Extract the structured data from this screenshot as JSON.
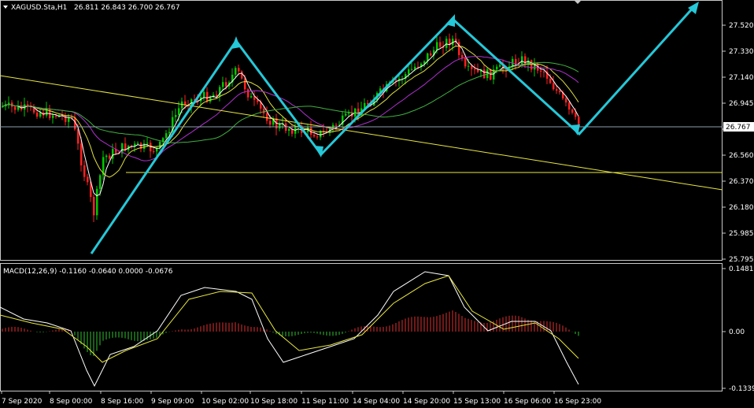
{
  "main": {
    "symbol": "XAGUSD.Sta,H1",
    "ohlc": "26.811 26.843 26.700 26.767",
    "price_ticks": [
      "27.520",
      "27.330",
      "27.140",
      "26.945",
      "26.760",
      "26.560",
      "26.370",
      "26.180",
      "25.985",
      "25.795"
    ],
    "current_price": "26.767",
    "ylim": [
      25.795,
      27.62
    ]
  },
  "macd": {
    "label": "MACD(12,26,9) -0.1160 -0.0640 0.0000 -0.0676",
    "ticks": [
      "0.1481",
      "0.00",
      "-0.1339"
    ],
    "ylim": [
      -0.1339,
      0.1481
    ]
  },
  "time_axis": {
    "labels": [
      "7 Sep 2020",
      "8 Sep 00:00",
      "8 Sep 16:00",
      "9 Sep 09:00",
      "10 Sep 02:00",
      "10 Sep 18:00",
      "11 Sep 11:00",
      "14 Sep 04:00",
      "14 Sep 20:00",
      "15 Sep 13:00",
      "16 Sep 06:00",
      "16 Sep 23:00"
    ]
  },
  "colors": {
    "bull": "#00c800",
    "bear": "#ff2020",
    "zigzag": "#25c8d8",
    "trendline": "#e8e840",
    "grid": "#c0c0c0",
    "macd_pos": "#e03030",
    "macd_neg": "#30c030"
  }
}
